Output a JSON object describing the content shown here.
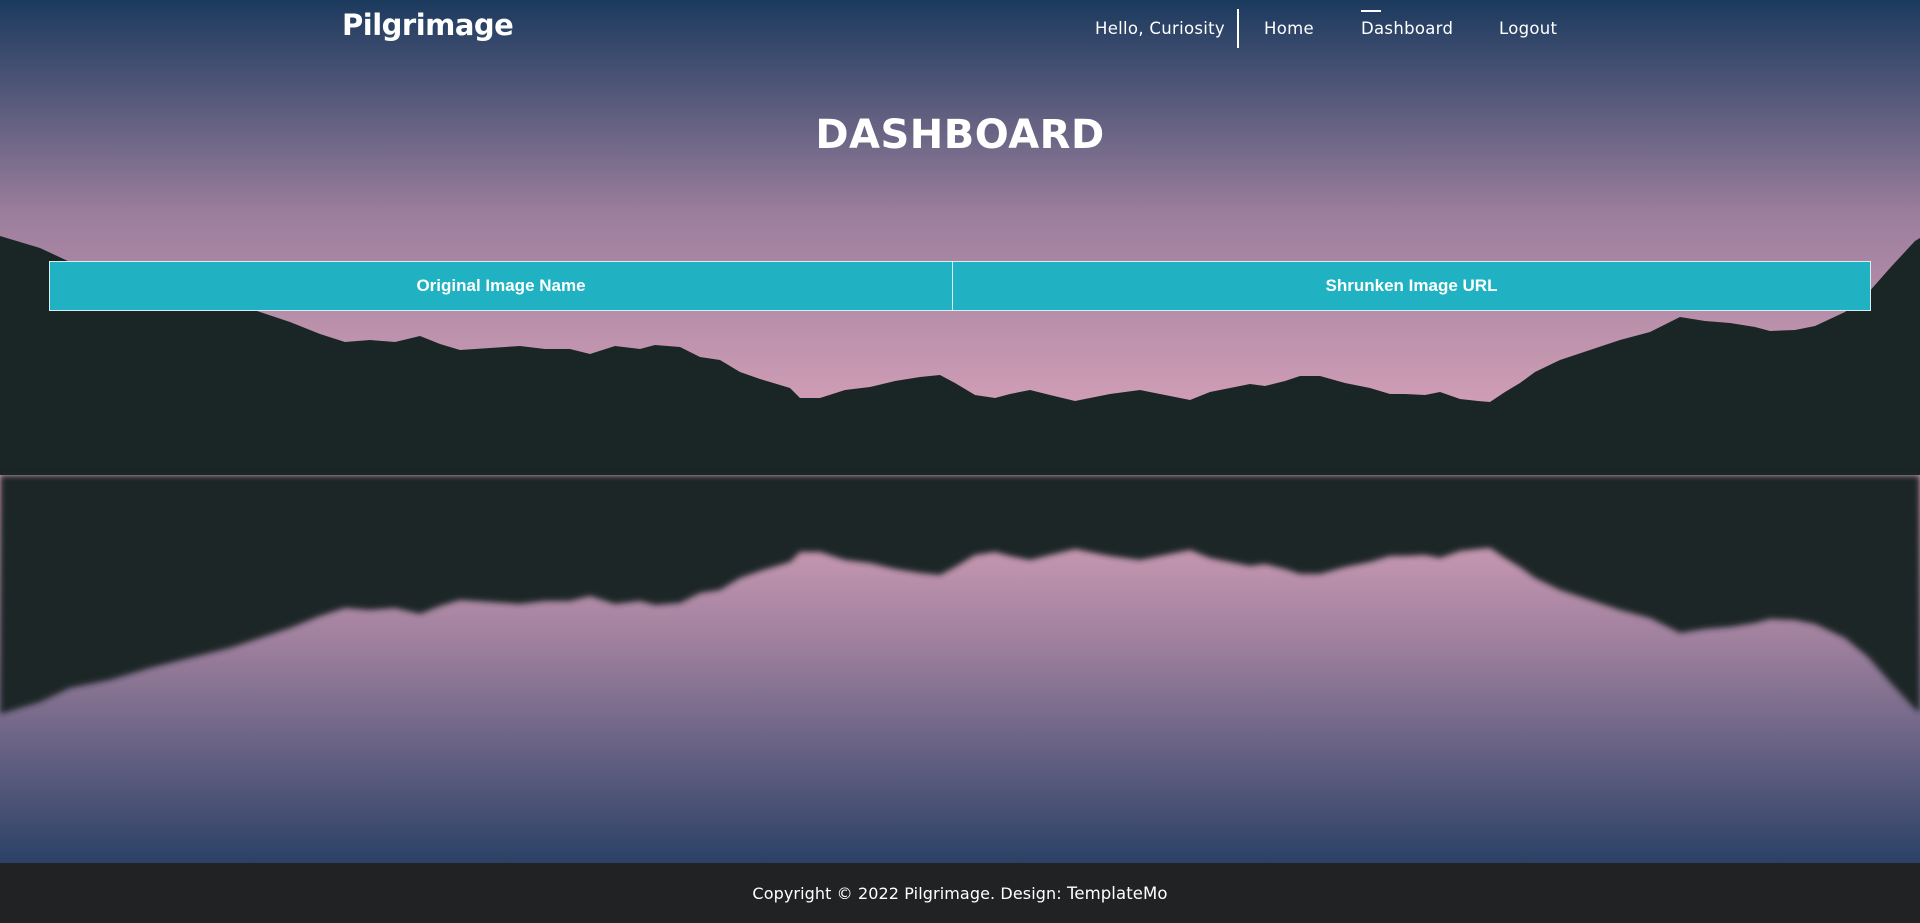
{
  "navbar": {
    "brand": "Pilgrimage",
    "greeting": "Hello, Curiosity",
    "links": [
      {
        "label": "Home"
      },
      {
        "label": "Dashboard",
        "active": true
      },
      {
        "label": "Logout"
      }
    ]
  },
  "page": {
    "title": "DASHBOARD"
  },
  "table": {
    "columns": [
      "Original Image Name",
      "Shrunken Image URL"
    ],
    "header_color": "#20b2c2"
  },
  "footer": {
    "copyright": "Copyright © 2022 Pilgrimage. Design: ",
    "credit_link": "TemplateMo"
  },
  "colors": {
    "sky_top": "#1b3a5e",
    "sky_horizon": "#e4a9bf",
    "mountain": "#1a2626",
    "footer": "#202224"
  }
}
